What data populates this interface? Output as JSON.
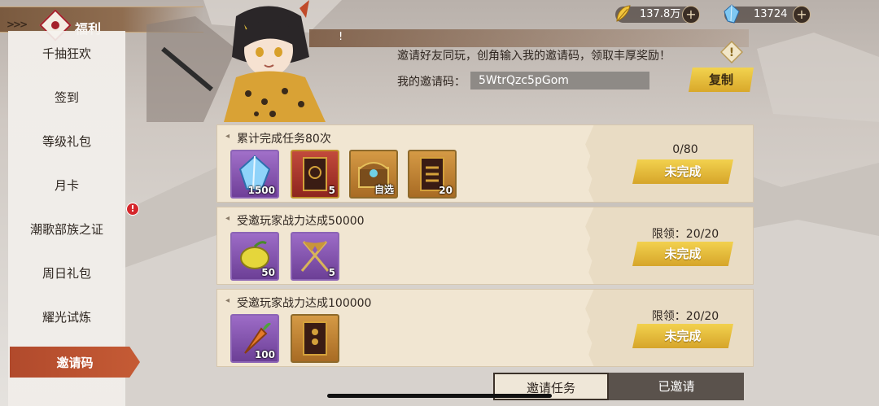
{
  "header": {
    "title": "福利",
    "chevrons": ">>>"
  },
  "currency": [
    {
      "icon": "gold-feather-icon",
      "value": "137.8万"
    },
    {
      "icon": "blue-crystal-icon",
      "value": "13724"
    }
  ],
  "sidebar": {
    "items": [
      {
        "label": "千抽狂欢"
      },
      {
        "label": "签到"
      },
      {
        "label": "等级礼包"
      },
      {
        "label": "月卡"
      },
      {
        "label": "潮歌部族之证"
      },
      {
        "label": "周日礼包"
      },
      {
        "label": "耀光试炼"
      },
      {
        "label": "邀请码"
      }
    ],
    "active_index": 7,
    "badge": "!"
  },
  "invite": {
    "banner_suffix": "!",
    "description": "邀请好友同玩，创角输入我的邀请码，领取丰厚奖励！",
    "code_label": "我的邀请码：",
    "code_value": "5WtrQzc5pGom",
    "copy_label": "复制"
  },
  "tasks": [
    {
      "title": "累计完成任务80次",
      "progress": "0/80",
      "button": "未完成",
      "rewards": [
        {
          "icon": "blue-crystal-icon",
          "count": "1500"
        },
        {
          "icon": "red-scroll-icon",
          "count": "5"
        },
        {
          "icon": "treasure-chest-icon",
          "count": "自选"
        },
        {
          "icon": "gold-scroll-icon",
          "count": "20"
        }
      ]
    },
    {
      "title": "受邀玩家战力达成50000",
      "progress": "限领：20/20",
      "button": "未完成",
      "rewards": [
        {
          "icon": "lemon-fruit-icon",
          "count": "50"
        },
        {
          "icon": "crossed-flags-icon",
          "count": "5"
        }
      ]
    },
    {
      "title": "受邀玩家战力达成100000",
      "progress": "限领：20/20",
      "button": "未完成",
      "rewards": [
        {
          "icon": "carrot-icon",
          "count": "100"
        },
        {
          "icon": "gold-scroll-icon",
          "count": ""
        }
      ]
    }
  ],
  "tabs": [
    {
      "label": "邀请任务",
      "active": true
    },
    {
      "label": "已邀请",
      "active": false
    }
  ]
}
